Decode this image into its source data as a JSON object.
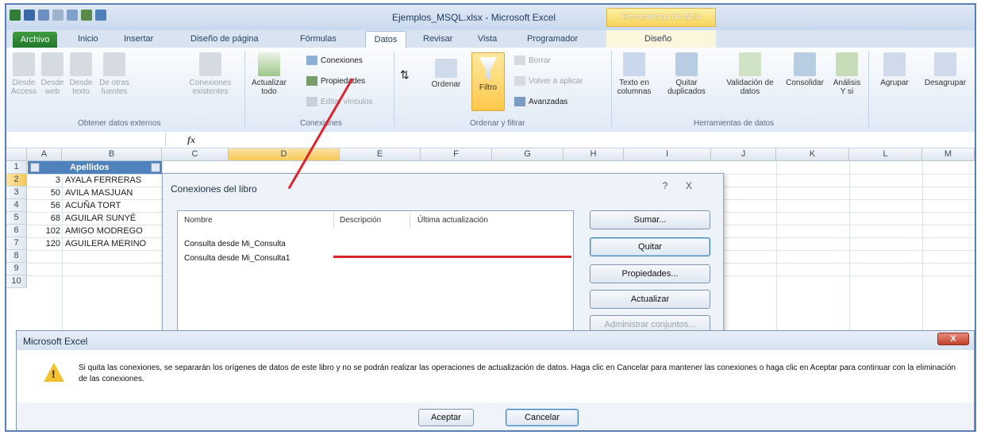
{
  "window": {
    "title": "Ejemplos_MSQL.xlsx  -  Microsoft Excel",
    "contextual_tab_group": "Herramientas de tabla"
  },
  "ribbon_tabs": [
    "Archivo",
    "Inicio",
    "Insertar",
    "Diseño de página",
    "Fórmulas",
    "Datos",
    "Revisar",
    "Vista",
    "Programador",
    "Diseño"
  ],
  "active_tab": "Datos",
  "ribbon": {
    "get_external": {
      "buttons": [
        "Desde Access",
        "Desde web",
        "Desde texto",
        "De otras fuentes",
        "Conexiones existentes"
      ],
      "group_label": "Obtener datos externos"
    },
    "connections": {
      "refresh_all": "Actualizar todo",
      "conexiones": "Conexiones",
      "propiedades": "Propiedades",
      "editar_vinculos": "Editar vínculos",
      "group_label": "Conexiones"
    },
    "sort_filter": {
      "ordenar": "Ordenar",
      "filtro": "Filtro",
      "borrar": "Borrar",
      "volver_aplicar": "Volver a aplicar",
      "avanzadas": "Avanzadas",
      "group_label": "Ordenar y filtrar"
    },
    "data_tools": {
      "texto_columnas": "Texto en columnas",
      "quitar_duplicados": "Quitar duplicados",
      "validacion": "Validación de datos",
      "consolidar": "Consolidar",
      "analisis": "Análisis Y si",
      "group_label": "Herramientas de datos"
    },
    "outline": {
      "agrupar": "Agrupar",
      "desagrupar": "Desagrupar"
    }
  },
  "formula_bar": {
    "fx": "fx"
  },
  "columns": [
    "A",
    "B",
    "C",
    "D",
    "E",
    "F",
    "G",
    "H",
    "I",
    "J",
    "K",
    "L",
    "M"
  ],
  "rows": [
    "1",
    "2",
    "3",
    "4",
    "5",
    "6",
    "7",
    "8",
    "9",
    "10"
  ],
  "sheet": {
    "header": "Apellidos",
    "ids": [
      "3",
      "50",
      "56",
      "68",
      "102",
      "120"
    ],
    "names": [
      "AYALA FERRERAS",
      "AVILA MASJUAN",
      "ACUÑA TORT",
      "AGUILAR SUNYÉ",
      "AMIGO MODREGO",
      "AGUILERA MERINO"
    ]
  },
  "connections_dialog": {
    "title": "Conexiones del libro",
    "help": "?",
    "close": "X",
    "columns": [
      "Nombre",
      "Descripción",
      "Última actualización"
    ],
    "items": [
      "Consulta desde Mi_Consulta",
      "Consulta desde Mi_Consulta1"
    ],
    "buttons": [
      "Sumar...",
      "Quitar",
      "Propiedades...",
      "Actualizar",
      "Administrar conjuntos..."
    ]
  },
  "message_box": {
    "title": "Microsoft Excel",
    "text": "Si quita las conexiones, se separarán los orígenes de datos de este libro y no se podrán realizar las operaciones de actualización de datos. Haga clic en Cancelar para mantener las conexiones o haga clic en Aceptar para continuar con la eliminación de las conexiones.",
    "ok": "Aceptar",
    "cancel": "Cancelar",
    "close": "X"
  },
  "colors": {
    "accent_red": "#d8262e",
    "archivo_green": "#2e8b37",
    "filter_yellow": "#ffc84a"
  }
}
